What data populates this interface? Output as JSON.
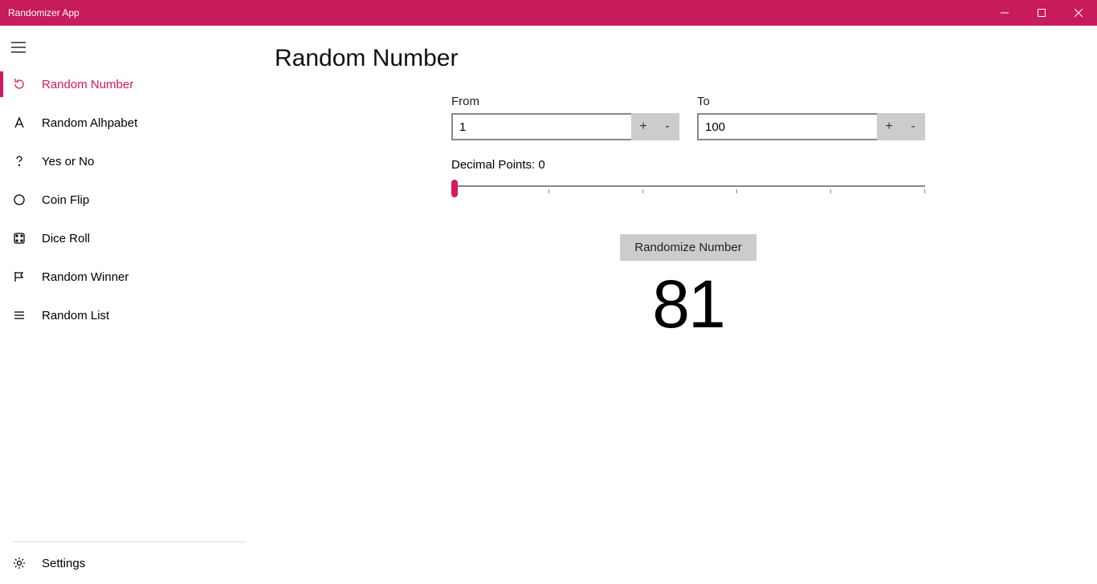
{
  "app": {
    "title": "Randomizer App"
  },
  "sidebar": {
    "items": [
      {
        "label": "Random Number"
      },
      {
        "label": "Random Alhpabet"
      },
      {
        "label": "Yes or No"
      },
      {
        "label": "Coin Flip"
      },
      {
        "label": "Dice Roll"
      },
      {
        "label": "Random Winner"
      },
      {
        "label": "Random List"
      }
    ],
    "settings_label": "Settings"
  },
  "page": {
    "title": "Random Number",
    "from_label": "From",
    "to_label": "To",
    "from_value": "1",
    "to_value": "100",
    "plus": "+",
    "minus": "-",
    "decimal_label": "Decimal Points: 0",
    "randomize_label": "Randomize Number",
    "result": "81"
  }
}
